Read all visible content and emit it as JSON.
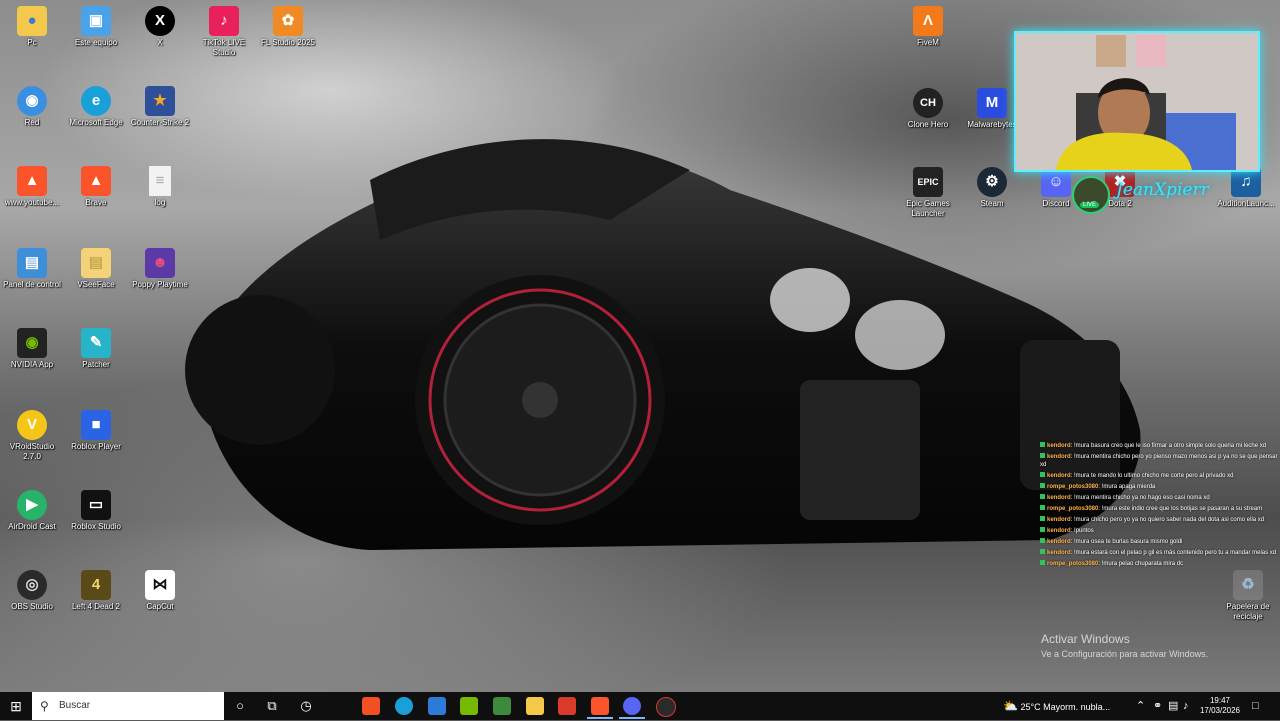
{
  "desktop_icons": [
    {
      "label": "Pc",
      "icon": "user-folder-icon",
      "color": "#f3c84b"
    },
    {
      "label": "Este equipo",
      "icon": "computer-icon",
      "color": "#4aa3e8"
    },
    {
      "label": "X",
      "icon": "x-logo-icon",
      "color": "#000000"
    },
    {
      "label": "TikTok LIVE Studio",
      "icon": "tiktok-live-icon",
      "color": "#e8205c"
    },
    {
      "label": "FL Studio 2025",
      "icon": "fl-studio-icon",
      "color": "#f08a24"
    },
    {
      "label": "Red",
      "icon": "network-icon",
      "color": "#3b8fe0"
    },
    {
      "label": "Microsoft Edge",
      "icon": "edge-icon",
      "color": "#1aa0d8"
    },
    {
      "label": "Counter-Strike 2",
      "icon": "counter-strike-icon",
      "color": "#2f4f9a"
    },
    {
      "label": "www.youtube...",
      "icon": "brave-shortcut-icon",
      "color": "#fb542b"
    },
    {
      "label": "Brave",
      "icon": "brave-icon",
      "color": "#fb542b"
    },
    {
      "label": "log",
      "icon": "text-file-icon",
      "color": "#f2f2f2"
    },
    {
      "label": "Panel de control",
      "icon": "control-panel-icon",
      "color": "#3f8fd8"
    },
    {
      "label": "VSeeFace",
      "icon": "folder-icon",
      "color": "#f3d27a"
    },
    {
      "label": "Poppy Playtime",
      "icon": "poppy-playtime-icon",
      "color": "#5b3aa8"
    },
    {
      "label": "NVIDIA App",
      "icon": "nvidia-icon",
      "color": "#76b900"
    },
    {
      "label": "Patcher",
      "icon": "patcher-icon",
      "color": "#27b3c8"
    },
    {
      "label": "VRoidStudio 2.7.0",
      "icon": "vroid-icon",
      "color": "#f5c517"
    },
    {
      "label": "Roblox Player",
      "icon": "roblox-player-icon",
      "color": "#2b63e5"
    },
    {
      "label": "AirDroid Cast",
      "icon": "airdroid-cast-icon",
      "color": "#27b36a"
    },
    {
      "label": "Roblox Studio",
      "icon": "roblox-studio-icon",
      "color": "#111111"
    },
    {
      "label": "OBS Studio",
      "icon": "obs-icon",
      "color": "#2a2a2a"
    },
    {
      "label": "Left 4 Dead 2",
      "icon": "left4dead-icon",
      "color": "#5a4a1a"
    },
    {
      "label": "CapCut",
      "icon": "capcut-icon",
      "color": "#111111"
    },
    {
      "label": "FiveM",
      "icon": "fivem-icon",
      "color": "#f27a1a"
    },
    {
      "label": "Clone Hero",
      "icon": "clone-hero-icon",
      "color": "#222222"
    },
    {
      "label": "Malwarebytes",
      "icon": "malwarebytes-icon",
      "color": "#2a4de0"
    },
    {
      "label": "Epic Games Launcher",
      "icon": "epic-games-icon",
      "color": "#222222"
    },
    {
      "label": "Steam",
      "icon": "steam-icon",
      "color": "#1b2838"
    },
    {
      "label": "Discord",
      "icon": "discord-icon",
      "color": "#5865f2"
    },
    {
      "label": "Dota 2",
      "icon": "dota-icon",
      "color": "#b32020"
    },
    {
      "label": "AuditionLaunc...",
      "icon": "audition-icon",
      "color": "#1c5fa0"
    },
    {
      "label": "Papelera de reciclaje",
      "icon": "recycle-bin-icon",
      "color": "#9fb7cf"
    }
  ],
  "stream_overlay": {
    "streamer_name": "JeanXpierr",
    "live_label": "LIVE"
  },
  "chat": [
    {
      "user": "kendord",
      "text": ": !mura basura creo que le iso firmar a otro simple solo queria mi leche xd"
    },
    {
      "user": "kendord",
      "text": ": !mura mentira chicho pero yo pienso mazo menos asi p ya no se que pensar xd"
    },
    {
      "user": "kendord",
      "text": ": !mura te mando lo ultimo chicho me corte pero al privado xd"
    },
    {
      "user": "rompe_potos3080",
      "text": ": !mura apaga mierda"
    },
    {
      "user": "kendord",
      "text": ": !mura mentira chicho ya no hago eso casi noma xd"
    },
    {
      "user": "rompe_potos3080",
      "text": ": !mura este indio cree que los botijas se pasaran a su stream"
    },
    {
      "user": "kendord",
      "text": ": !mura chicho pero yo ya no quiero saber nada del dota asi como ella xd"
    },
    {
      "user": "kendord",
      "text": ": !puntos"
    },
    {
      "user": "kendord",
      "text": ": !mura osea te burlas basura mismo goldi"
    },
    {
      "user": "kendord",
      "text": ": !mura estará con el pelao p gil es más contenido pero tu a mandar melas xd"
    },
    {
      "user": "rompe_potos3080",
      "text": ": !mura pelao chuparata mira dc"
    }
  ],
  "activation": {
    "title": "Activar Windows",
    "subtitle": "Ve a Configuración para activar Windows."
  },
  "taskbar": {
    "search_placeholder": "Buscar",
    "apps": [
      "microsoft-store-icon",
      "edge-icon",
      "mail-icon",
      "nvidia-icon",
      "terminal-icon",
      "file-explorer-icon",
      "app-red-icon",
      "brave-icon",
      "discord-overlay-icon",
      "obs-icon"
    ],
    "weather": "25°C  Mayorm. nubla...",
    "time": "19:47",
    "date": "17/03/2026"
  }
}
